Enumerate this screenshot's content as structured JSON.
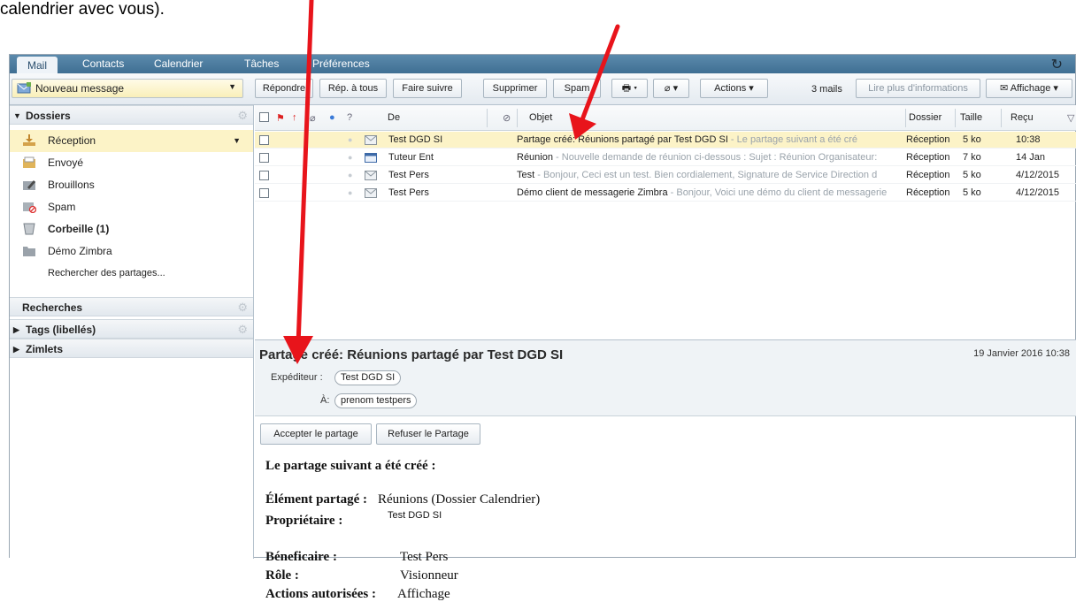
{
  "caption": "calendrier avec vous).",
  "tabs": [
    {
      "label": "Mail"
    },
    {
      "label": "Contacts"
    },
    {
      "label": "Calendrier"
    },
    {
      "label": "Tâches"
    },
    {
      "label": "Préférences"
    }
  ],
  "toolbar": {
    "new_message": "Nouveau message",
    "reply": "Répondre",
    "reply_all": "Rép. à tous",
    "forward": "Faire suivre",
    "delete": "Supprimer",
    "spam": "Spam",
    "actions": "Actions",
    "mail_count": "3 mails",
    "more_info": "Lire plus d'informations",
    "view": "Affichage"
  },
  "sidebar": {
    "folders_header": "Dossiers",
    "folders": [
      {
        "label": "Réception",
        "icon": "inbox-icon"
      },
      {
        "label": "Envoyé",
        "icon": "sent-icon"
      },
      {
        "label": "Brouillons",
        "icon": "drafts-icon"
      },
      {
        "label": "Spam",
        "icon": "spam-icon"
      },
      {
        "label": "Corbeille (1)",
        "icon": "trash-icon"
      },
      {
        "label": "Démo Zimbra",
        "icon": "folder-icon"
      }
    ],
    "search_shares": "Rechercher des partages...",
    "searches_header": "Recherches",
    "tags_header": "Tags (libellés)",
    "zimlets_header": "Zimlets"
  },
  "list": {
    "headers": {
      "from": "De",
      "subject": "Objet",
      "folder": "Dossier",
      "size": "Taille",
      "received": "Reçu"
    },
    "rows": [
      {
        "from": "Test DGD SI",
        "subject": "Partage créé: Réunions partagé par  Test DGD SI",
        "fragment": " - Le partage suivant a été cré",
        "folder": "Réception",
        "size": "5 ko",
        "date": "10:38"
      },
      {
        "from": "Tuteur Ent",
        "subject": "Réunion",
        "fragment": " - Nouvelle demande de réunion ci-dessous : Sujet : Réunion Organisateur:",
        "folder": "Réception",
        "size": "7 ko",
        "date": "14 Jan"
      },
      {
        "from": "Test Pers",
        "subject": "Test",
        "fragment": " - Bonjour, Ceci est un test. Bien cordialement, Signature de Service Direction d",
        "folder": "Réception",
        "size": "5 ko",
        "date": "4/12/2015"
      },
      {
        "from": "Test Pers",
        "subject": "Démo client de messagerie Zimbra",
        "fragment": " - Bonjour, Voici une démo du client de messagerie",
        "folder": "Réception",
        "size": "5 ko",
        "date": "4/12/2015"
      }
    ]
  },
  "reading": {
    "title": "Partage créé: Réunions partagé par  Test DGD SI",
    "date": "19 Janvier 2016 10:38",
    "sender_label": "Expéditeur :",
    "sender": "Test DGD SI",
    "to_label": "À:",
    "to": "prenom testpers",
    "accept": "Accepter le partage",
    "refuse": "Refuser le Partage",
    "intro": "Le partage suivant a été créé :",
    "shared_item_label": "Élément partagé :",
    "shared_item_value": "Réunions (Dossier Calendrier)",
    "owner_label": "Propriétaire :",
    "owner_value": "Test DGD SI",
    "beneficiary_label": "Béneficaire :",
    "beneficiary_value": "Test Pers",
    "role_label": "Rôle :",
    "role_value": "Visionneur",
    "actions_label": "Actions autorisées :",
    "actions_value": "Affichage"
  },
  "colors": {
    "accent": "#3f6f93",
    "selected": "#fcf3c7",
    "annotation": "#e8141b"
  }
}
